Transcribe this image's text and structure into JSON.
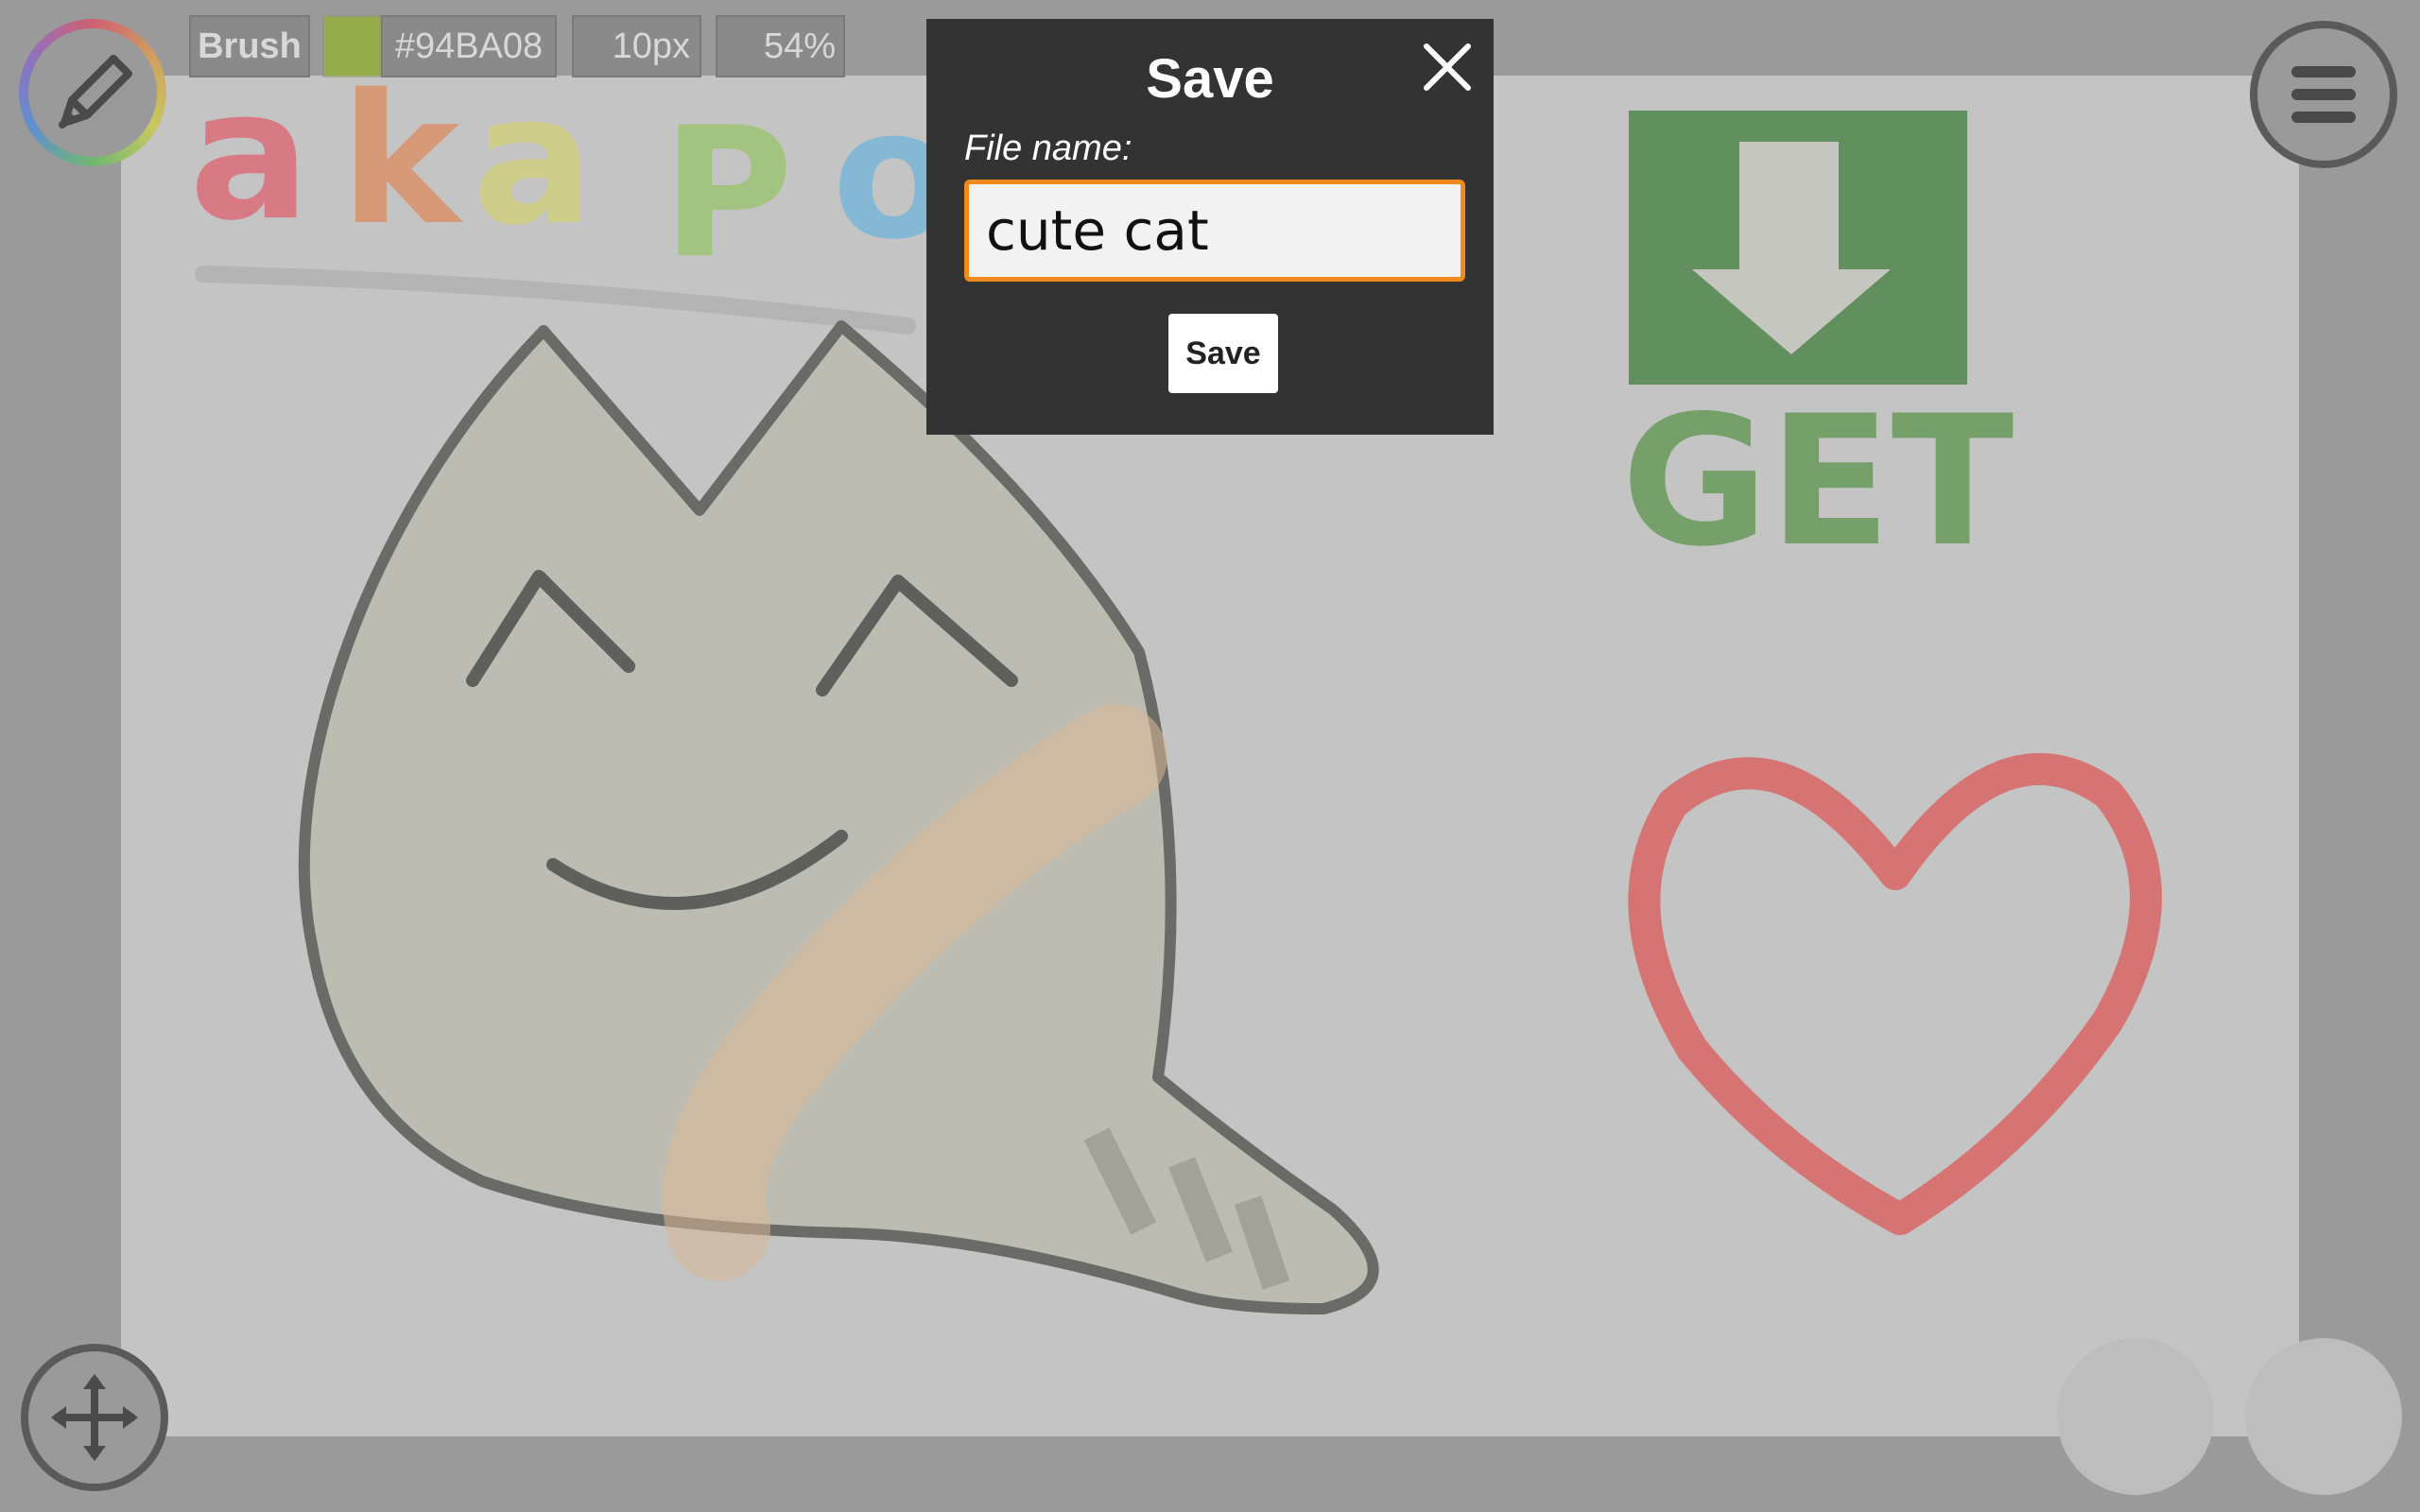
{
  "toolbar": {
    "tool_label": "Brush",
    "color_hex": "#94BA08",
    "size_label": "10px",
    "opacity_label": "54%"
  },
  "icons": {
    "tool": "pencil-icon",
    "menu": "hamburger-menu-icon",
    "move": "move-arrows-icon",
    "close": "close-icon"
  },
  "canvas": {
    "background_color": "#c4c4c4",
    "doodle_title_text": "akaPo",
    "doodle_get_text": "GET"
  },
  "dialog": {
    "title": "Save",
    "file_name_label": "File name:",
    "file_name_value": "cute cat",
    "save_button_label": "Save"
  },
  "colors": {
    "accent_orange": "#f08a1c",
    "dialog_bg": "#333333",
    "brush_color": "#94BA08"
  }
}
